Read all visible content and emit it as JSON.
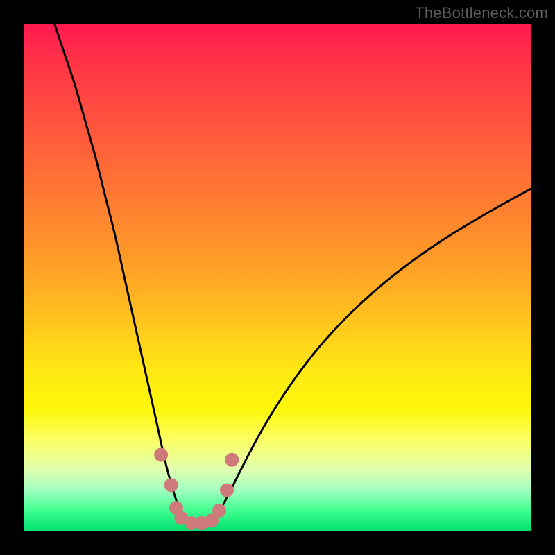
{
  "watermark": "TheBottleneck.com",
  "colors": {
    "gradient_top": "#ff1a4f",
    "gradient_mid": "#ffe714",
    "gradient_bottom": "#00e070",
    "curve": "#000000",
    "dots": "#cf7a7a"
  },
  "chart_data": {
    "type": "line",
    "title": "",
    "xlabel": "",
    "ylabel": "",
    "xlim": [
      0,
      100
    ],
    "ylim": [
      0,
      100
    ],
    "annotations": [
      {
        "x": 27,
        "y": 15
      },
      {
        "x": 29,
        "y": 9
      },
      {
        "x": 30,
        "y": 4.5
      },
      {
        "x": 31,
        "y": 2.5
      },
      {
        "x": 33,
        "y": 1.5
      },
      {
        "x": 35,
        "y": 1.5
      },
      {
        "x": 37,
        "y": 2.0
      },
      {
        "x": 38.5,
        "y": 4.0
      },
      {
        "x": 40,
        "y": 8
      },
      {
        "x": 41,
        "y": 14
      }
    ],
    "series": [
      {
        "name": "left-branch",
        "x": [
          6,
          8,
          10,
          12,
          14,
          16,
          18,
          20,
          22,
          24,
          26,
          28,
          30,
          31,
          32,
          33,
          34
        ],
        "values": [
          100,
          94,
          88,
          81,
          74,
          66,
          58,
          49,
          40,
          31,
          22,
          13,
          6,
          3.5,
          2.2,
          1.5,
          1.2
        ]
      },
      {
        "name": "right-branch",
        "x": [
          34,
          35,
          36,
          37,
          38,
          40,
          43,
          47,
          52,
          58,
          65,
          73,
          82,
          91,
          100
        ],
        "values": [
          1.2,
          1.3,
          1.6,
          2.2,
          3.2,
          6.5,
          12.5,
          20.0,
          28.0,
          36.0,
          43.5,
          50.5,
          57.0,
          62.5,
          67.5
        ]
      }
    ]
  }
}
